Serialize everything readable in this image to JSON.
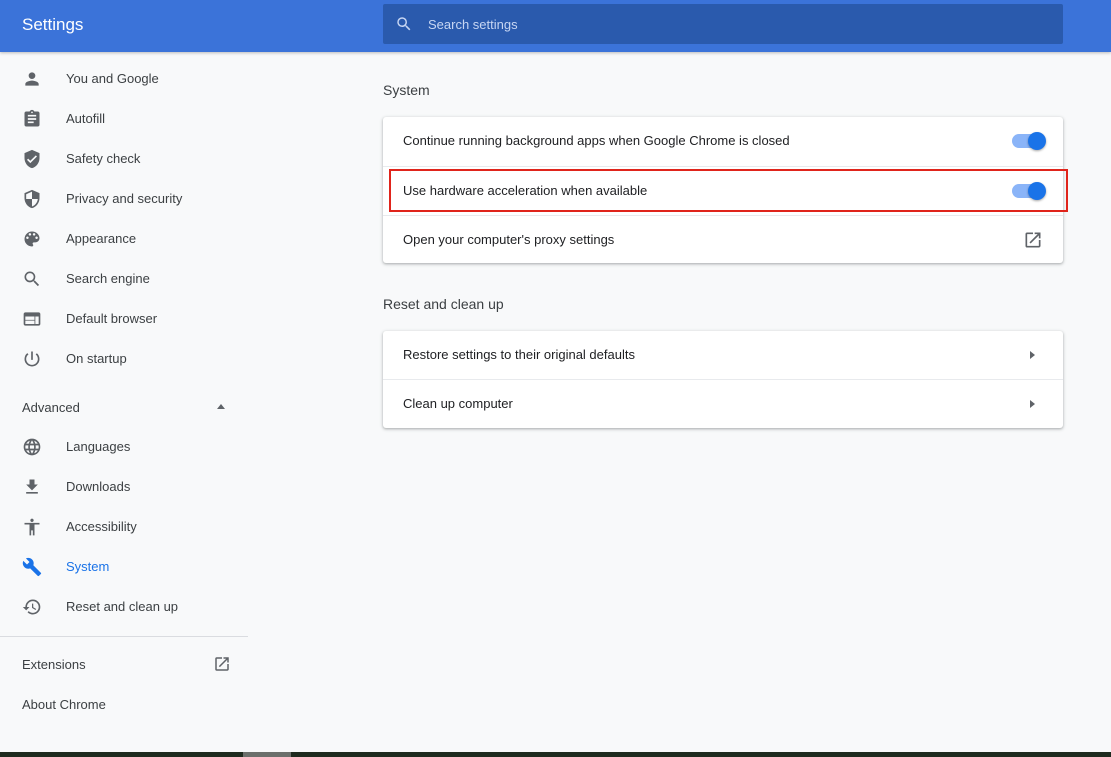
{
  "header": {
    "title": "Settings",
    "search_placeholder": "Search settings"
  },
  "sidebar": {
    "items": [
      {
        "label": "You and Google",
        "icon": "person-icon"
      },
      {
        "label": "Autofill",
        "icon": "clipboard-icon"
      },
      {
        "label": "Safety check",
        "icon": "shield-check-icon"
      },
      {
        "label": "Privacy and security",
        "icon": "shield-icon"
      },
      {
        "label": "Appearance",
        "icon": "palette-icon"
      },
      {
        "label": "Search engine",
        "icon": "search-icon"
      },
      {
        "label": "Default browser",
        "icon": "browser-icon"
      },
      {
        "label": "On startup",
        "icon": "power-icon"
      }
    ],
    "advanced_label": "Advanced",
    "advanced_items": [
      {
        "label": "Languages",
        "icon": "globe-icon"
      },
      {
        "label": "Downloads",
        "icon": "download-icon"
      },
      {
        "label": "Accessibility",
        "icon": "accessibility-icon"
      },
      {
        "label": "System",
        "icon": "wrench-icon",
        "active": true
      },
      {
        "label": "Reset and clean up",
        "icon": "history-icon"
      }
    ],
    "extensions_label": "Extensions",
    "about_label": "About Chrome"
  },
  "main": {
    "system_section": {
      "title": "System",
      "rows": [
        {
          "label": "Continue running background apps when Google Chrome is closed",
          "control": "toggle",
          "checked": true
        },
        {
          "label": "Use hardware acceleration when available",
          "control": "toggle",
          "checked": true,
          "highlighted": true
        },
        {
          "label": "Open your computer's proxy settings",
          "control": "external-link"
        }
      ]
    },
    "reset_section": {
      "title": "Reset and clean up",
      "rows": [
        {
          "label": "Restore settings to their original defaults",
          "control": "arrow"
        },
        {
          "label": "Clean up computer",
          "control": "arrow"
        }
      ]
    }
  },
  "colors": {
    "header": "#3b73d9",
    "accent": "#1a73e8",
    "highlight": "#e0241b"
  }
}
